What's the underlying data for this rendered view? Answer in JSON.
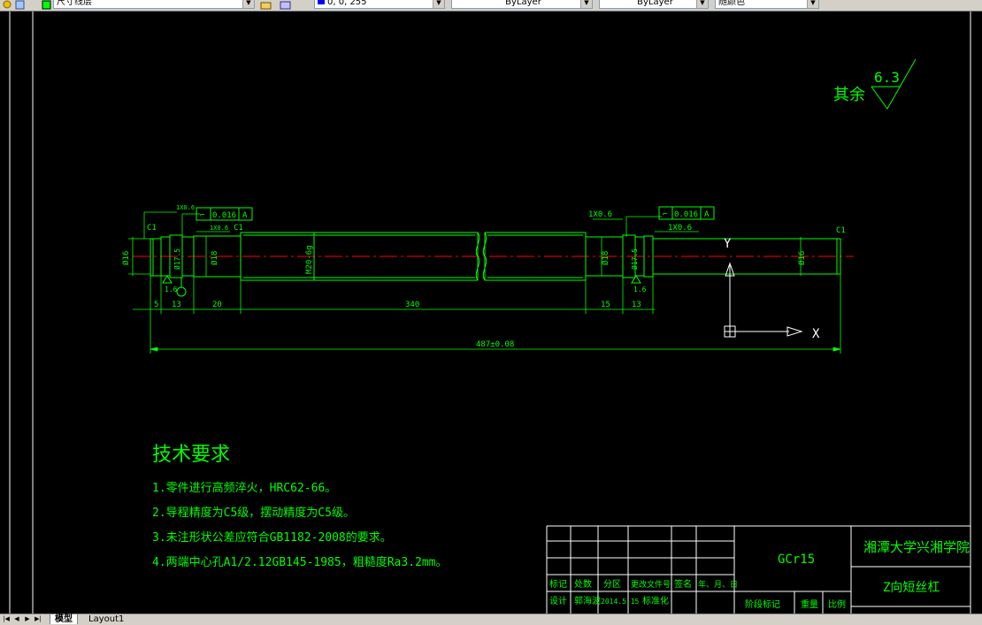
{
  "toolbar": {
    "layer_text": "尺寸线层",
    "color_text": "0, 0, 255",
    "linetype_text": "ByLayer",
    "lineweight_text": "ByLayer",
    "plotstyle_text": "随颜色"
  },
  "colors": {
    "background": "#000000",
    "lines": "#00ff00",
    "centerline": "#ff0000",
    "crosshair": "#ffffff",
    "frame": "#ffffff"
  },
  "drawing": {
    "roughness": {
      "label": "其余",
      "value": "6.3"
    },
    "gtol": [
      {
        "symbol": "⌐",
        "tolerance": "0.016",
        "datum": "A"
      },
      {
        "symbol": "⌐",
        "tolerance": "0.016",
        "datum": "A"
      }
    ],
    "dims": {
      "chamfer_left": "C1",
      "chamfer_mid": "C1",
      "chamfer_right": "C1",
      "dia_left": "Ø16",
      "dia_groove_left": "Ø17.5",
      "dia_shoulder_left": "Ø18",
      "thread": "M20-6g",
      "dia_shoulder_right": "Ø18",
      "dia_groove_right": "Ø17.5",
      "dia_right": "Ø16",
      "groove_top_left": "1X0.6",
      "groove_top_left2": "1X0.6",
      "groove_top_right": "1X0.6",
      "groove_top_right2": "1X0.6",
      "rough_a": "1.6",
      "rough_b": "1.6",
      "len_5": "5",
      "len_13a": "13",
      "len_20": "20",
      "len_340": "340",
      "len_15": "15",
      "len_13b": "13",
      "total_length": "487±0.08"
    },
    "ucs": {
      "y_label": "Y",
      "x_label": "X"
    }
  },
  "tech_requirements": {
    "title": "技术要求",
    "items": [
      "1.零件进行高频淬火，HRC62-66。",
      "2.导程精度为C5级，摆动精度为C5级。",
      "3.未注形状公差应符合GB1182-2008的要求。",
      "4.两端中心孔A1/2.12GB145-1985，粗糙度Ra3.2mm。"
    ]
  },
  "title_block": {
    "material": "GCr15",
    "school": "湘潭大学兴湘学院",
    "part_name": "Z向短丝杠",
    "row_labels": [
      "标记",
      "处数",
      "分区",
      "更改文件号",
      "签名",
      "年、月、日"
    ],
    "design_row": [
      "设计",
      "郭海波",
      "2014.5.15",
      "标准化"
    ],
    "stage_label": "阶段标记",
    "weight_label": "重量",
    "scale_label": "比例"
  },
  "tabs": {
    "model": "模型",
    "layout1": "Layout1"
  }
}
